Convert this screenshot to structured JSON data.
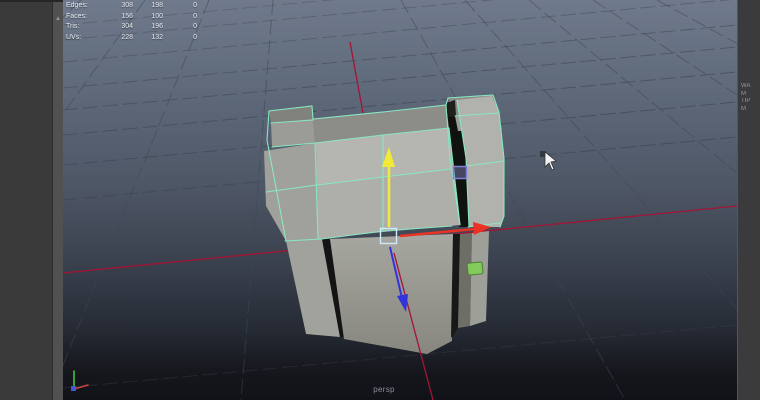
{
  "viewport": {
    "camera_label": "persp"
  },
  "hud": {
    "rows": [
      {
        "label": "Edges:",
        "total": "308",
        "selected": "198",
        "other": "0"
      },
      {
        "label": "Faces:",
        "total": "156",
        "selected": "100",
        "other": "0"
      },
      {
        "label": "Tris:",
        "total": "304",
        "selected": "196",
        "other": "0"
      },
      {
        "label": "UVs:",
        "total": "228",
        "selected": "132",
        "other": "0"
      }
    ]
  },
  "right_panel": {
    "lines": [
      "WA",
      "M",
      "TIP",
      "M"
    ]
  },
  "icons": {
    "scrollbar_up_arrow": "▲"
  },
  "colors": {
    "manipulator_y_active": "#f2ea38",
    "manipulator_x": "#ea3325",
    "manipulator_z": "#3333dd",
    "manipulator_center": "#cfeaf8",
    "wireframe_selected": "#88e7c3",
    "grid_axis": "#a51335",
    "handle_purple": "#8080d8",
    "handle_green": "#84ca5b"
  }
}
